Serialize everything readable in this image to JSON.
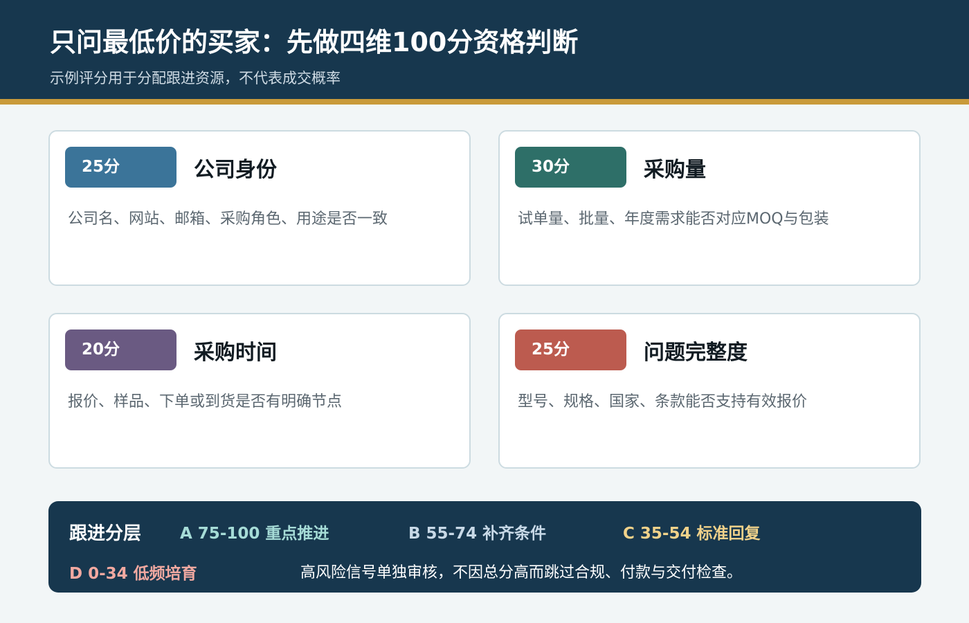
{
  "header": {
    "title": "只问最低价的买家：先做四维100分资格判断",
    "subtitle": "示例评分用于分配跟进资源，不代表成交概率"
  },
  "cards": [
    {
      "score": "25分",
      "title": "公司身份",
      "description": "公司名、网站、邮箱、采购角色、用途是否一致",
      "color": "#3b7499"
    },
    {
      "score": "30分",
      "title": "采购量",
      "description": "试单量、批量、年度需求能否对应MOQ与包装",
      "color": "#2e6f68"
    },
    {
      "score": "20分",
      "title": "采购时间",
      "description": "报价、样品、下单或到货是否有明确节点",
      "color": "#6a5a82"
    },
    {
      "score": "25分",
      "title": "问题完整度",
      "description": "型号、规格、国家、条款能否支持有效报价",
      "color": "#bc5b4f"
    }
  ],
  "tiers": {
    "label": "跟进分层",
    "a": "A 75-100 重点推进",
    "b": "B 55-74 补齐条件",
    "c": "C 35-54 标准回复",
    "d": "D 0-34 低频培育",
    "note": "高风险信号单独审核，不因总分高而跳过合规、付款与交付检查。"
  }
}
